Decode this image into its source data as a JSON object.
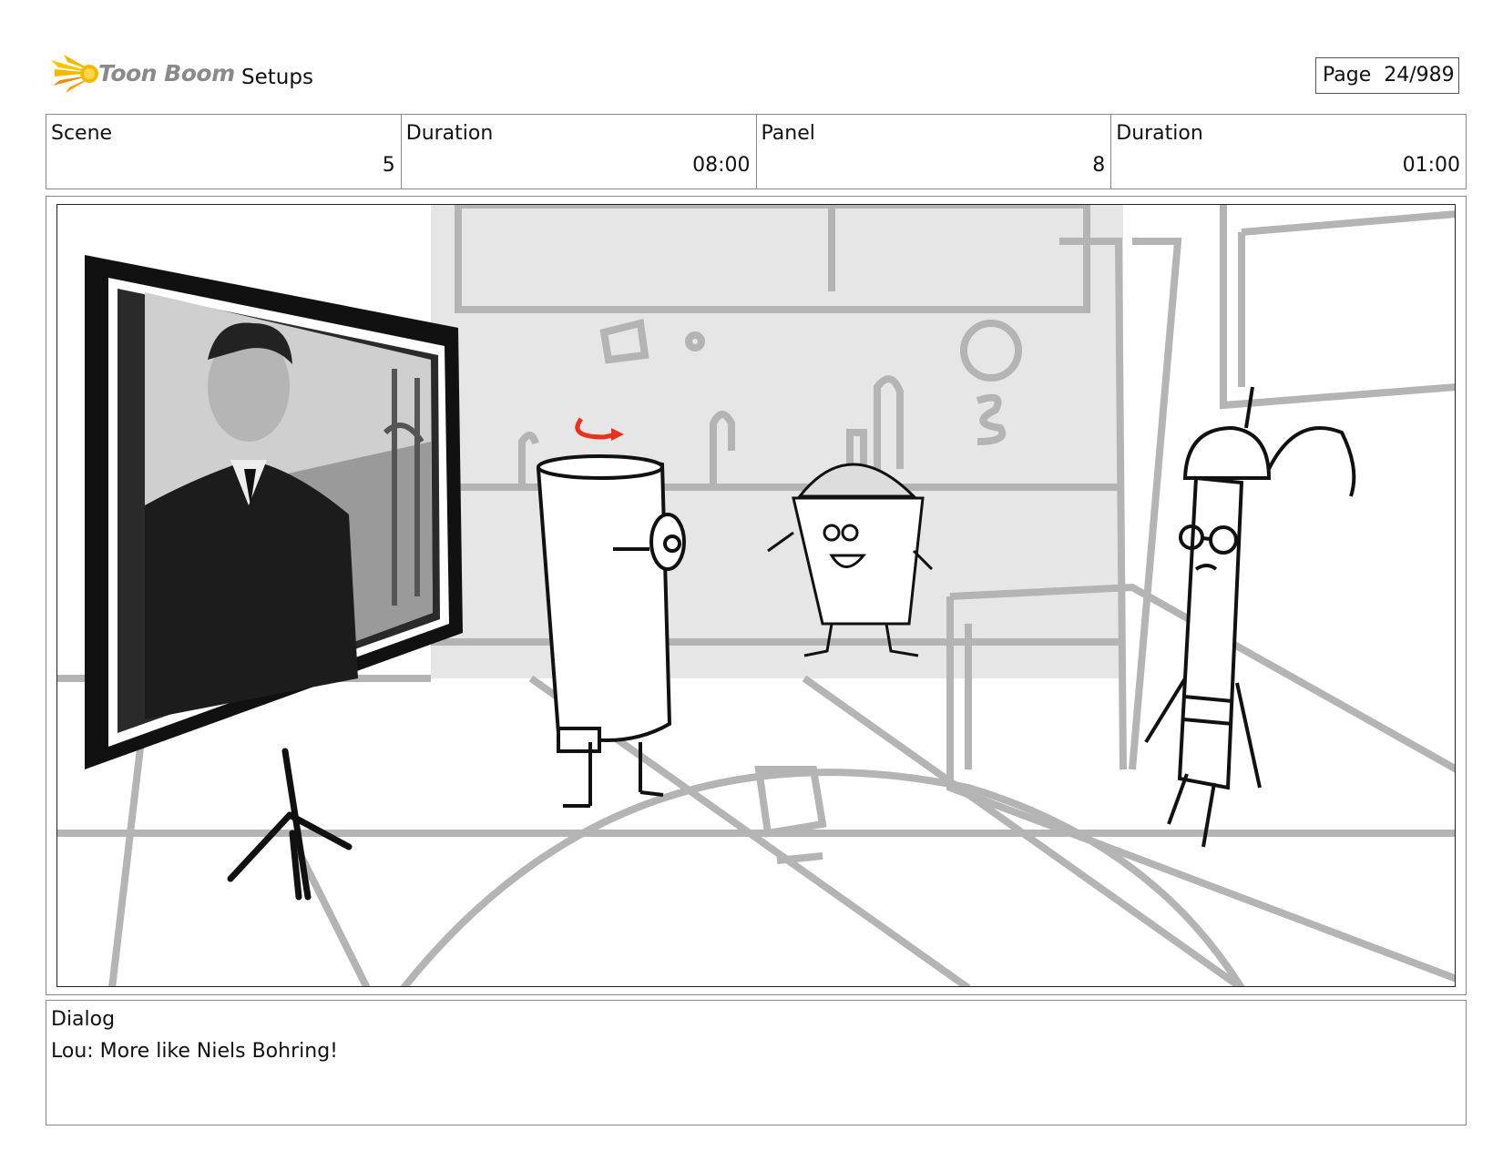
{
  "header": {
    "logo_text": "Toon Boom",
    "section": "Setups",
    "page_label": "Page",
    "page_value": "24/989"
  },
  "info": {
    "scene_label": "Scene",
    "scene_value": "5",
    "scene_duration_label": "Duration",
    "scene_duration_value": "08:00",
    "panel_label": "Panel",
    "panel_value": "8",
    "panel_duration_label": "Duration",
    "panel_duration_value": "01:00"
  },
  "dialog": {
    "label": "Dialog",
    "text": "Lou: More like Niels Bohring!"
  },
  "colors": {
    "logo_yellow": "#f5b800",
    "logo_orange": "#f08a00",
    "sketch_gray": "#b4b4b4",
    "background_fill": "#e6e6e6",
    "ink": "#111111",
    "rotation_arrow": "#e8321e"
  }
}
